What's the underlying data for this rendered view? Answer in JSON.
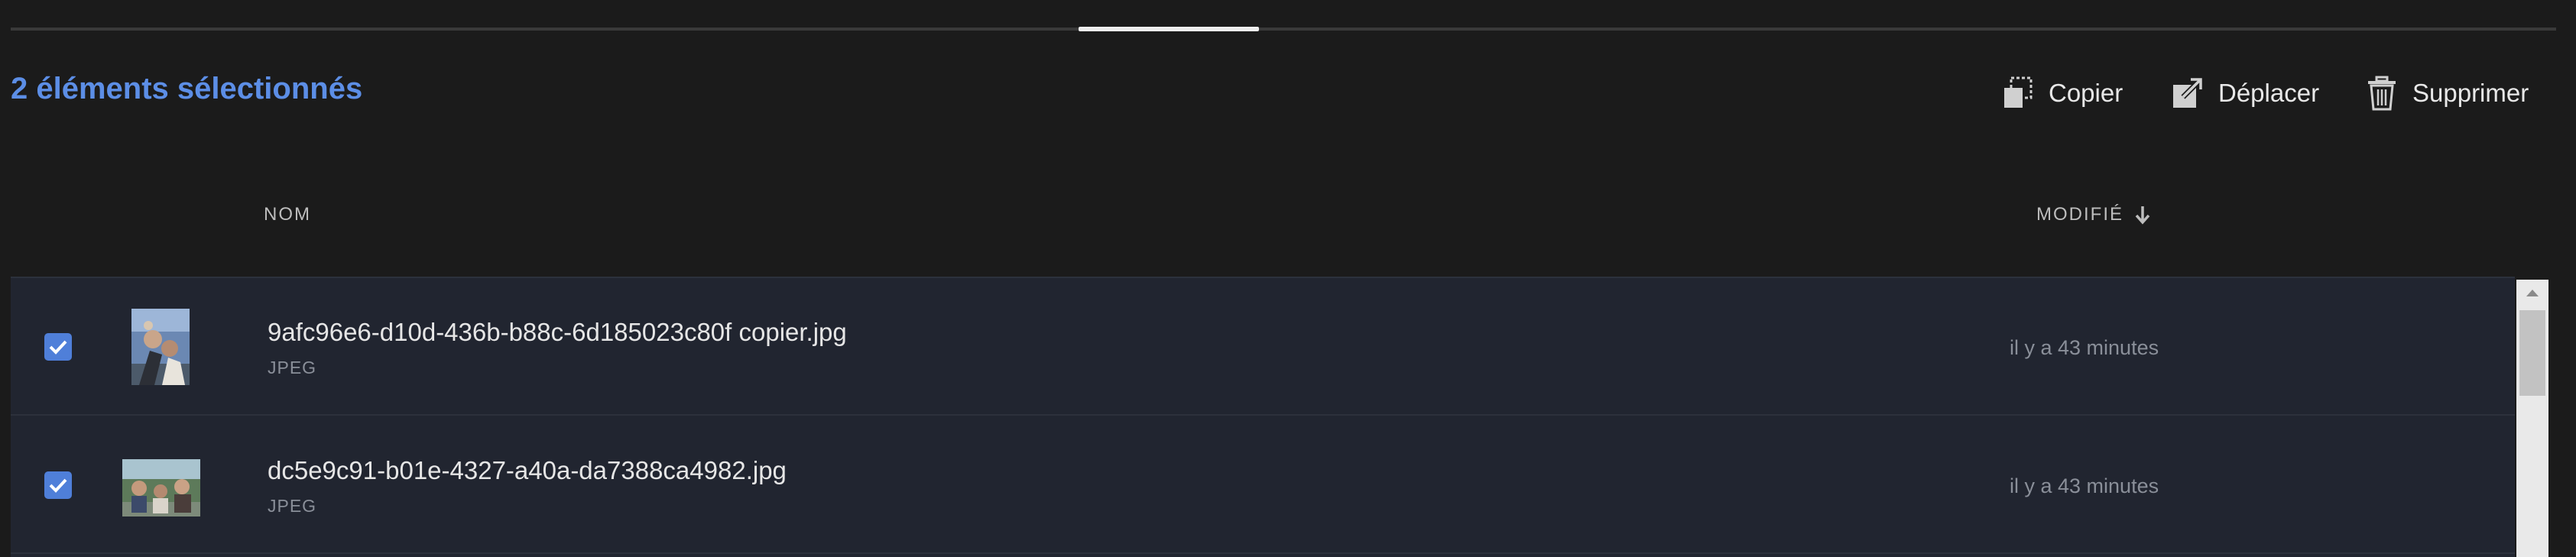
{
  "tabs_indicator": {
    "active_index": 1
  },
  "selection": {
    "count_text": "2 éléments sélectionnés"
  },
  "actions": {
    "copy_label": "Copier",
    "move_label": "Déplacer",
    "delete_label": "Supprimer"
  },
  "columns": {
    "name": "NOM",
    "modified": "MODIFIÉ",
    "modified_sort": "descending"
  },
  "files": [
    {
      "name": "9afc96e6-d10d-436b-b88c-6d185023c80f copier.jpg",
      "type": "JPEG",
      "modified": "il y a 43 minutes",
      "selected": true
    },
    {
      "name": "dc5e9c91-b01e-4327-a40a-da7388ca4982.jpg",
      "type": "JPEG",
      "modified": "il y a 43 minutes",
      "selected": true
    }
  ],
  "colors": {
    "background": "#1b1b1b",
    "accent": "#5c8ee6",
    "checkbox": "#4f7fd9",
    "row_background": "#212530"
  },
  "icons": {
    "copy": "copy-icon",
    "move": "move-icon",
    "delete": "trash-icon",
    "sort": "arrow-down-icon",
    "check": "check-icon"
  }
}
